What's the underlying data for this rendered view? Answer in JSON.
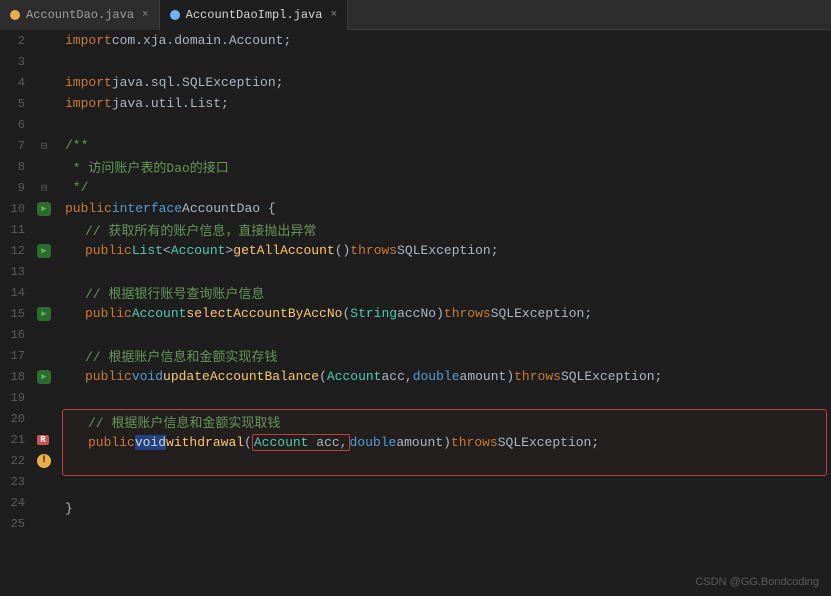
{
  "tabs": [
    {
      "id": "tab1",
      "label": "AccountDao.java",
      "type": "java",
      "active": false
    },
    {
      "id": "tab2",
      "label": "AccountDaoImpl.java",
      "type": "impl",
      "active": true
    }
  ],
  "lines": [
    {
      "num": 2,
      "content": "import com.xja.domain.Account;",
      "gutter": ""
    },
    {
      "num": 3,
      "content": "",
      "gutter": ""
    },
    {
      "num": 4,
      "content": "import java.sql.SQLException;",
      "gutter": ""
    },
    {
      "num": 5,
      "content": "import java.util.List;",
      "gutter": ""
    },
    {
      "num": 6,
      "content": "",
      "gutter": ""
    },
    {
      "num": 7,
      "content": "/**",
      "gutter": "fold"
    },
    {
      "num": 8,
      "content": " * 访问账户表的Dao的接口",
      "gutter": ""
    },
    {
      "num": 9,
      "content": " */",
      "gutter": "fold"
    },
    {
      "num": 10,
      "content": "public interface AccountDao {",
      "gutter": "run"
    },
    {
      "num": 11,
      "content": "    // 获取所有的账户信息，直接抛出异常",
      "gutter": ""
    },
    {
      "num": 12,
      "content": "    public List<Account> getAllAccount() throws SQLException;",
      "gutter": "run"
    },
    {
      "num": 13,
      "content": "",
      "gutter": ""
    },
    {
      "num": 14,
      "content": "    // 根据银行账号查询账户信息",
      "gutter": ""
    },
    {
      "num": 15,
      "content": "    public Account selectAccountByAccNo (String accNo) throws SQLException;",
      "gutter": "run"
    },
    {
      "num": 16,
      "content": "",
      "gutter": ""
    },
    {
      "num": 17,
      "content": "    // 根据账户信息和金额实现存钱",
      "gutter": ""
    },
    {
      "num": 18,
      "content": "    public void updateAccountBalance(Account acc, double amount) throws SQLException;",
      "gutter": "run"
    },
    {
      "num": 19,
      "content": "",
      "gutter": ""
    },
    {
      "num": 20,
      "content": "    // 根据账户信息和金额实现取钱",
      "gutter": "error-start"
    },
    {
      "num": 21,
      "content": "    public void withdrawal(Account acc, double amount) throws SQLException;",
      "gutter": "error-run"
    },
    {
      "num": 22,
      "content": "",
      "gutter": "error-end"
    },
    {
      "num": 23,
      "content": "",
      "gutter": ""
    },
    {
      "num": 24,
      "content": "}",
      "gutter": ""
    }
  ],
  "watermark": "CSDN @GG.Bondcoding",
  "throws_word": "throws",
  "error_line_num": 22
}
